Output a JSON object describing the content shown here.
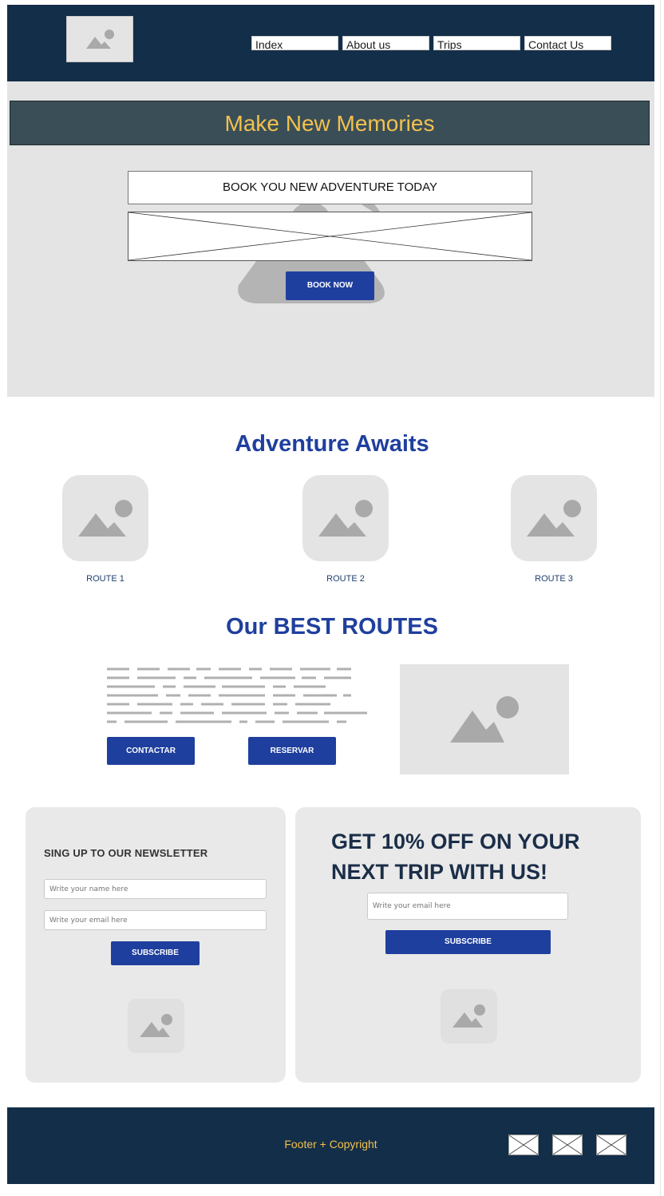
{
  "header": {
    "logo_icon": "image-placeholder-icon",
    "nav": [
      "Index",
      "About us",
      "Trips",
      "Contact Us"
    ]
  },
  "hero": {
    "title": "Make New Memories",
    "cta_text": "BOOK YOU NEW ADVENTURE TODAY",
    "book_button": "BOOK NOW",
    "colors": {
      "banner": "#3a4e58",
      "title": "#f2c14e",
      "button": "#1f3f9e"
    }
  },
  "adventure": {
    "title": "Adventure Awaits",
    "routes": [
      {
        "label": "ROUTE 1",
        "icon": "image-placeholder-icon"
      },
      {
        "label": "ROUTE 2",
        "icon": "image-placeholder-icon"
      },
      {
        "label": "ROUTE 3",
        "icon": "image-placeholder-icon"
      }
    ]
  },
  "best_routes": {
    "title": "Our BEST ROUTES",
    "contact_button": "CONTACTAR",
    "reserve_button": "RESERVAR"
  },
  "newsletter": {
    "title": "SING UP TO OUR NEWSLETTER",
    "name_placeholder": "Write your name here",
    "email_placeholder": "Write your email here",
    "subscribe_button": "SUBSCRIBE"
  },
  "promo": {
    "title": "GET 10% OFF ON YOUR NEXT TRIP WITH US!",
    "email_placeholder": "Write your email here",
    "subscribe_button": "SUBSCRIBE"
  },
  "footer": {
    "text": "Footer + Copyright",
    "social_icons": [
      "mail-icon",
      "mail-icon",
      "mail-icon"
    ],
    "colors": {
      "background": "#132e48",
      "text": "#f2c14e"
    }
  }
}
